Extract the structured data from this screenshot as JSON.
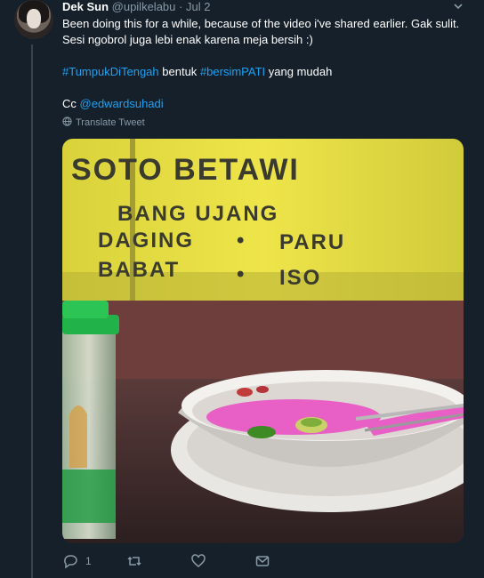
{
  "tweet": {
    "author_name": "Dek Sun",
    "handle": "@upilkelabu",
    "separator": "·",
    "date": "Jul 2",
    "line1": "Been doing this for a while, because of the  video i've shared earlier. Gak sulit.",
    "line2": "Sesi ngobrol juga lebi enak karena meja bersih :)",
    "hashtag1": "#TumpukDiTengah",
    "word_between": "bentuk",
    "hashtag2": "#bersimPATI",
    "word_after": "yang mudah",
    "cc_prefix": "Cc",
    "mention": "@edwardsuhadi",
    "translate_label": "Translate Tweet"
  },
  "photo": {
    "sign_line1": "SOTO BETAWI",
    "sign_line2": "BANG UJANG",
    "sign_line3a": "DAGING",
    "sign_dot": "•",
    "sign_line3b": "PARU",
    "sign_line4a": "BABAT",
    "sign_line4b": "ISO"
  },
  "actions": {
    "reply_count": "1",
    "retweet_count": "",
    "like_count": ""
  },
  "icons": {
    "reply": "reply-icon",
    "retweet": "retweet-icon",
    "like": "heart-icon",
    "share": "mail-icon",
    "more": "chevron-down-icon",
    "translate": "globe-icon"
  },
  "colors": {
    "background": "#15202b",
    "link": "#1da1f2",
    "secondary": "#8899a6",
    "sign_yellow": "#e9e043"
  }
}
